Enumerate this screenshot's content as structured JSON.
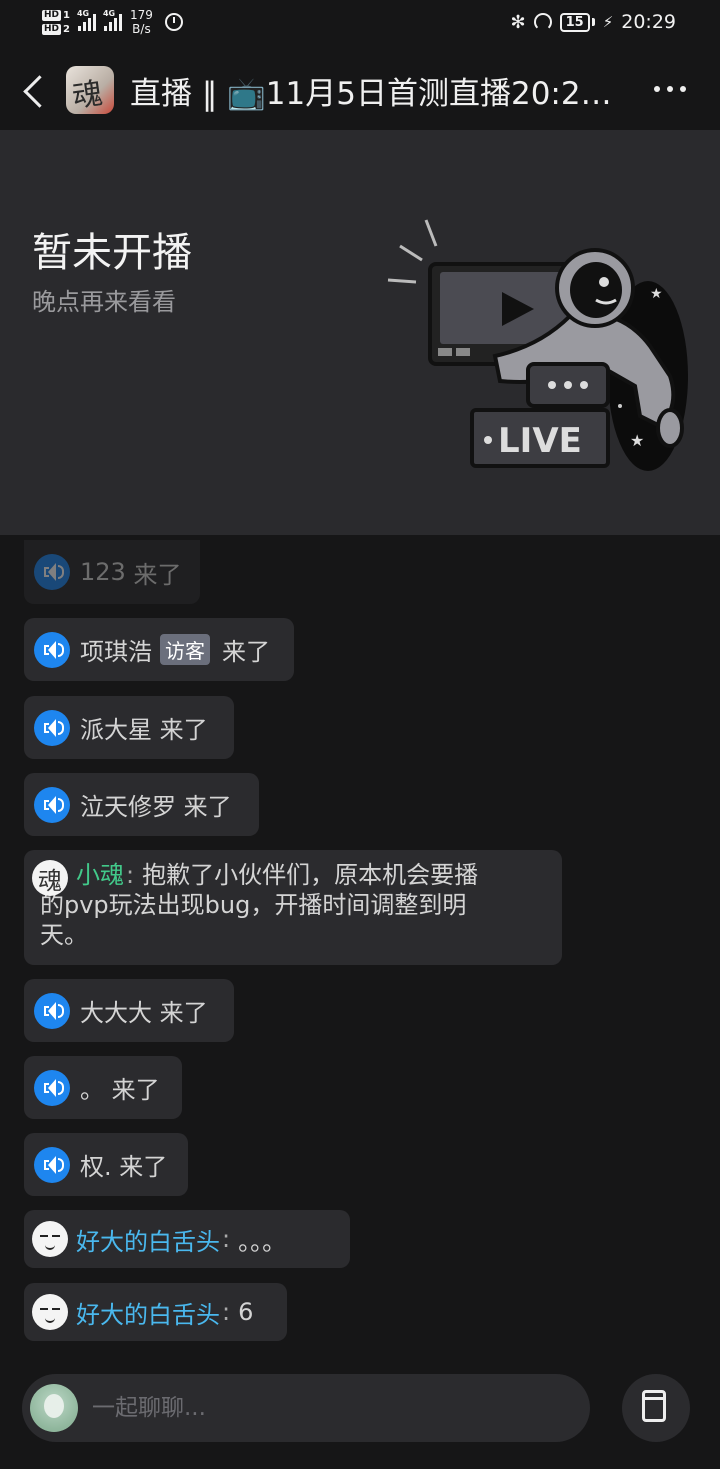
{
  "status_bar": {
    "hd1": "HD",
    "hd1_n": "1",
    "hd2": "HD",
    "hd2_n": "2",
    "net1": "4G",
    "net2": "4G",
    "speed_value": "179",
    "speed_unit": "B/s",
    "battery": "15",
    "time": "20:29"
  },
  "header": {
    "title": "直播 ‖ 📺11月5日首测直播20:2…",
    "avatar_char": "魂"
  },
  "banner": {
    "title": "暂未开播",
    "subtitle": "晚点再来看看",
    "live_text": "LIVE"
  },
  "chat": [
    {
      "type": "join",
      "name": "123",
      "suffix": "来了",
      "faded": true
    },
    {
      "type": "join",
      "name": "项琪浩",
      "badge": "访客",
      "suffix": "来了"
    },
    {
      "type": "join",
      "name": "派大星",
      "suffix": "来了"
    },
    {
      "type": "join",
      "name": "泣天修罗",
      "suffix": "来了"
    },
    {
      "type": "message",
      "name": "小魂",
      "line1": "抱歉了小伙伴们，原本机会要播",
      "line2": "的pvp玩法出现bug，开播时间调整到明",
      "line3": "天。",
      "avatar_char": "魂"
    },
    {
      "type": "join",
      "name": "大大大",
      "suffix": "来了"
    },
    {
      "type": "join",
      "name": "。",
      "suffix": "来了"
    },
    {
      "type": "join",
      "name": "权.",
      "suffix": "来了"
    },
    {
      "type": "message",
      "name": "好大的白舌头",
      "text": "。。。"
    },
    {
      "type": "message",
      "name": "好大的白舌头",
      "text": "6"
    }
  ],
  "input": {
    "placeholder": "一起聊聊..."
  },
  "colors": {
    "background": "#161617",
    "bubble": "#2b2b2e",
    "banner": "#2a2a2d",
    "speaker": "#1e86ef",
    "name_green": "#42c98a",
    "name_blue": "#4ab8ee"
  }
}
